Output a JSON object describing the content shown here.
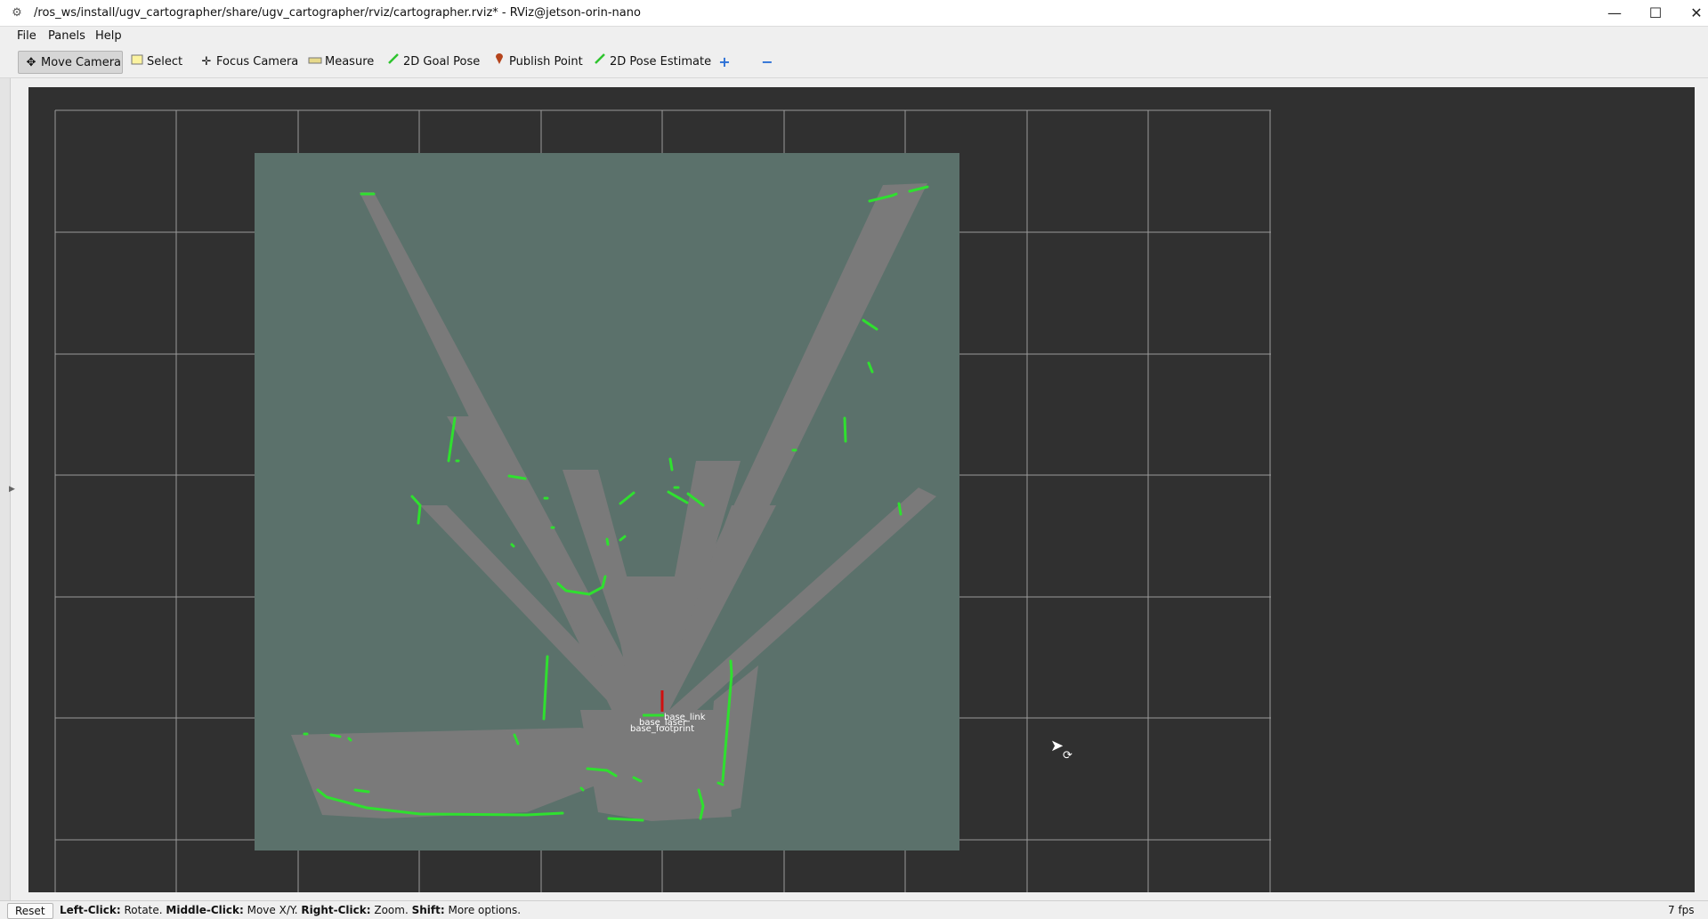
{
  "window": {
    "title": "/ros_ws/install/ugv_cartographer/share/ugv_cartographer/rviz/cartographer.rviz* - RViz@jetson-orin-nano",
    "minimize": "—",
    "maximize": "☐",
    "close": "✕"
  },
  "menu": {
    "file": "File",
    "panels": "Panels",
    "help": "Help"
  },
  "toolbar": {
    "move_camera": "Move Camera",
    "select": "Select",
    "focus_camera": "Focus Camera",
    "measure": "Measure",
    "goal_pose": "2D Goal Pose",
    "publish_point": "Publish Point",
    "pose_estimate": "2D Pose Estimate",
    "add": "+",
    "remove": "−"
  },
  "viewport": {
    "tf_labels": [
      "base_link",
      "base_laser",
      "base_footprint"
    ]
  },
  "statusbar": {
    "reset": "Reset",
    "hint_left_key": "Left-Click:",
    "hint_left_val": " Rotate. ",
    "hint_middle_key": "Middle-Click:",
    "hint_middle_val": " Move X/Y. ",
    "hint_right_key": "Right-Click:",
    "hint_right_val": " Zoom. ",
    "hint_shift_key": "Shift:",
    "hint_shift_val": " More options.",
    "fps": "7 fps"
  },
  "colors": {
    "viewport_bg": "#303030",
    "map_unknown": "#5b716b",
    "map_free": "#7a7a7a",
    "laser_points": "#2fe02f",
    "grid": "#a0a0a0"
  }
}
